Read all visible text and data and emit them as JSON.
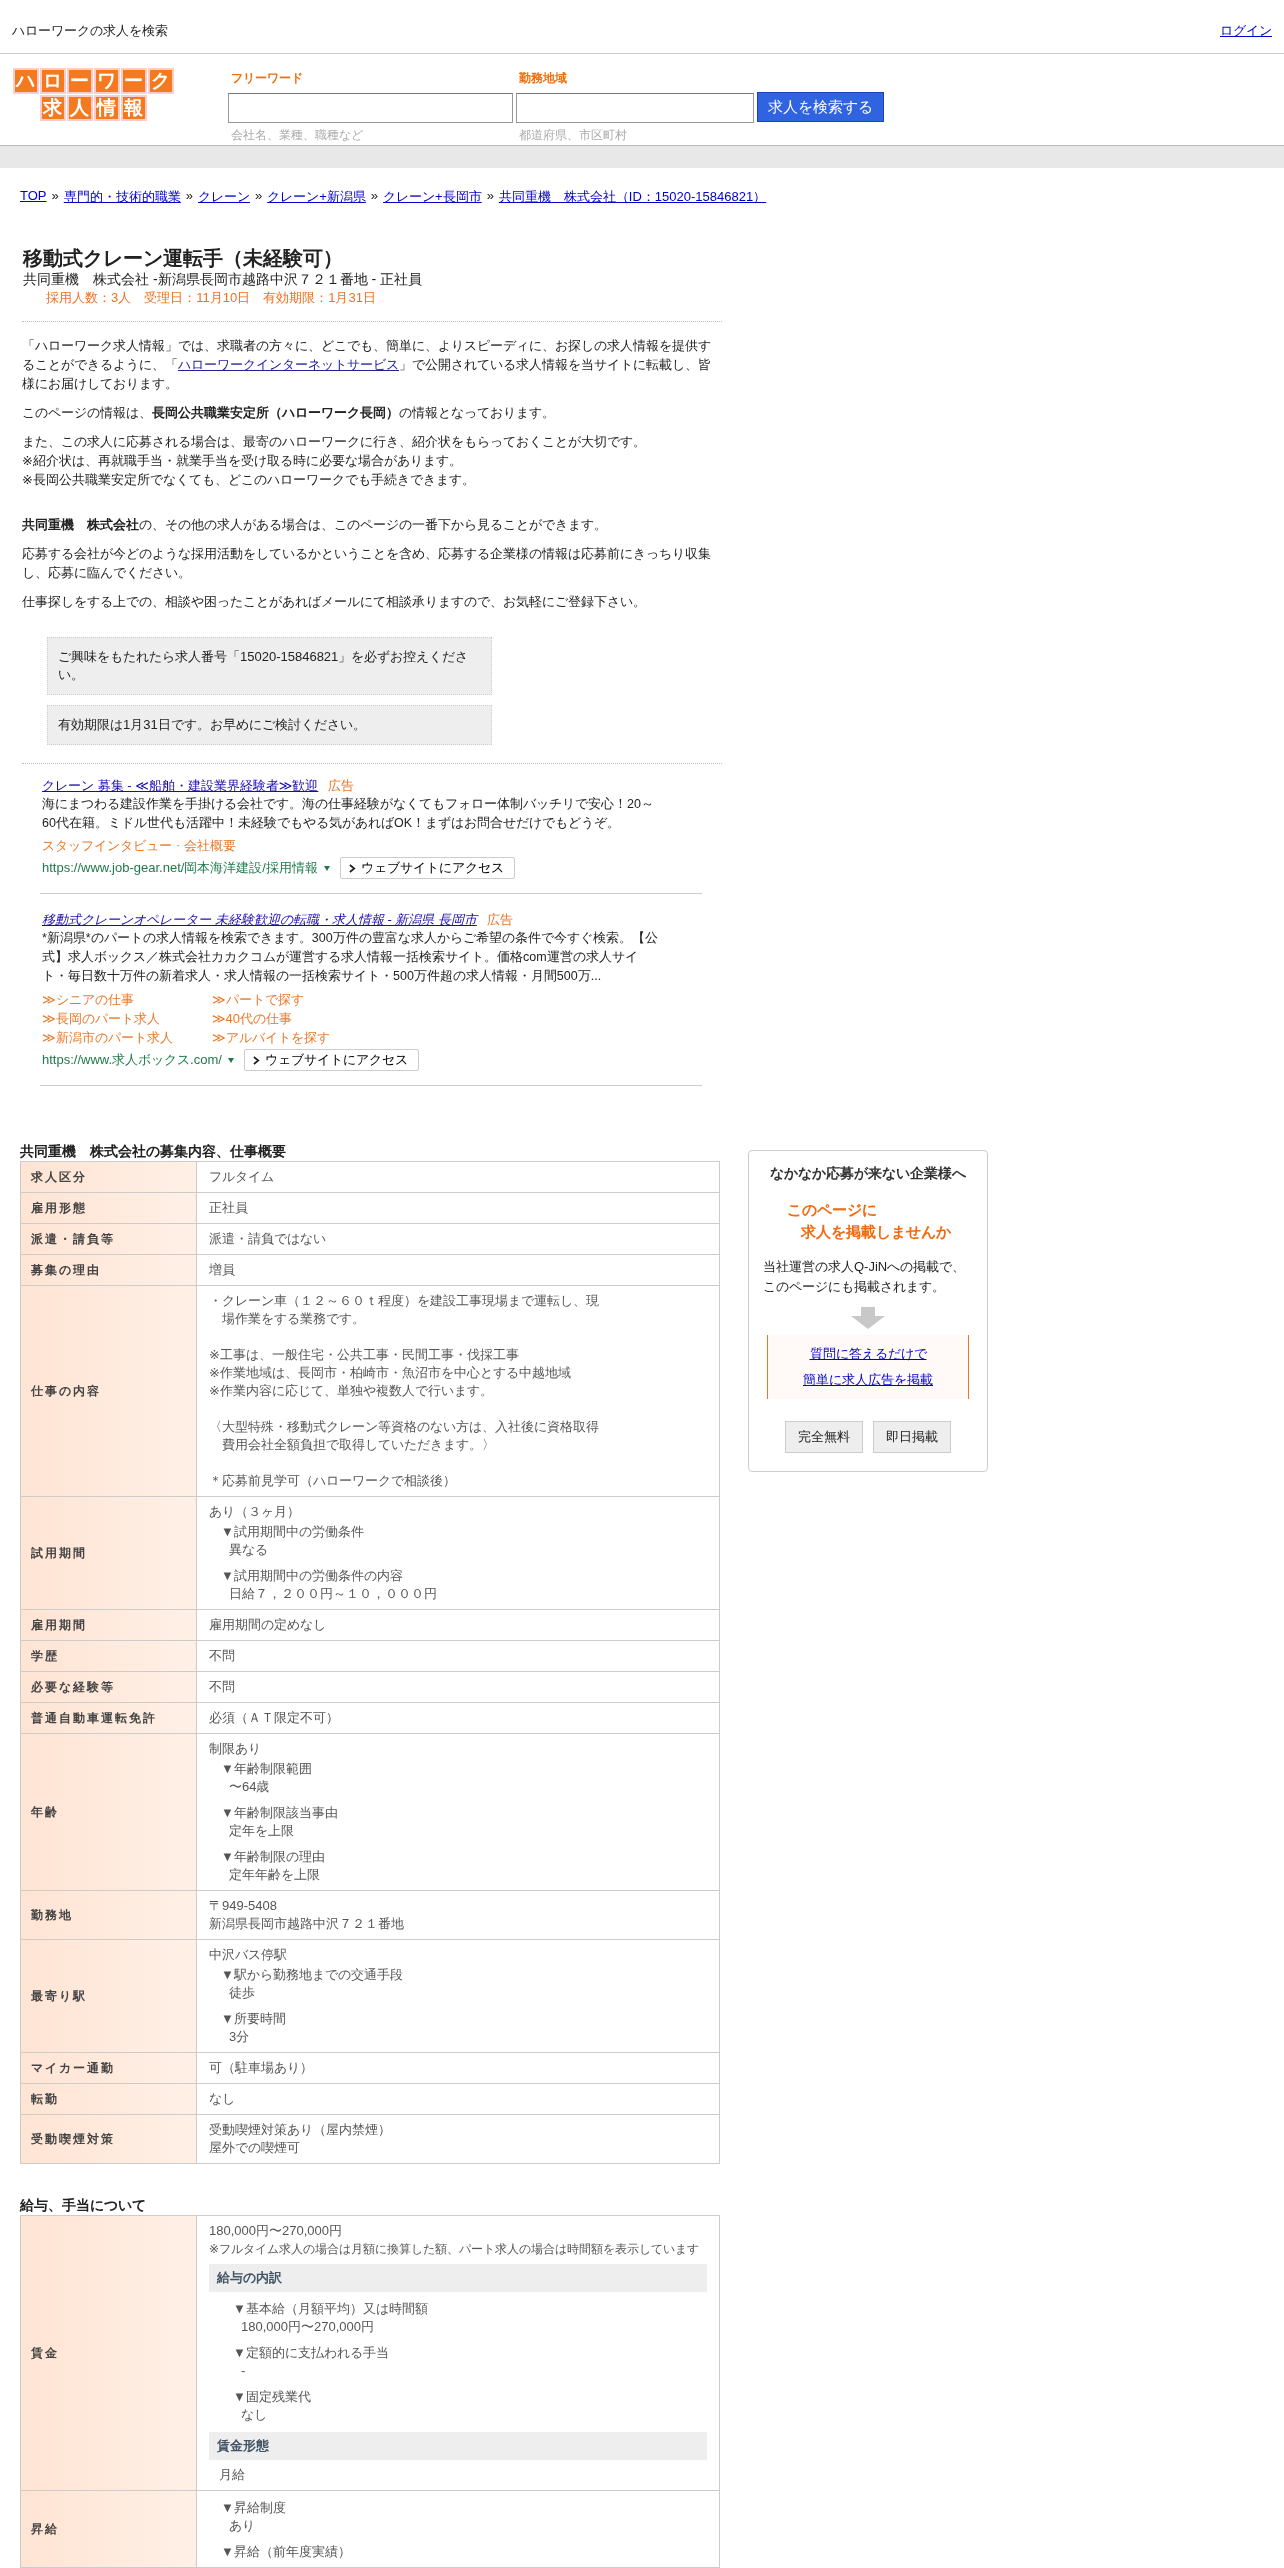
{
  "header": {
    "tagline": "ハローワークの求人を検索",
    "login": "ログイン"
  },
  "logo": {
    "top": [
      "ハ",
      "ロ",
      "ー",
      "ワ",
      "ー",
      "ク"
    ],
    "bottom": [
      "求",
      "人",
      "情",
      "報"
    ]
  },
  "search": {
    "fields": [
      {
        "label": "フリーワード",
        "placeholder": "会社名、業種、職種など",
        "kind": "wide"
      },
      {
        "label": "勤務地域",
        "placeholder": "都道府県、市区町村",
        "kind": "narrow"
      }
    ],
    "button": "求人を検索する"
  },
  "breadcrumb": {
    "separator": "»",
    "items": [
      "TOP",
      "専門的・技術的職業",
      "クレーン",
      "クレーン+新潟県",
      "クレーン+長岡市",
      "共同重機　株式会社（ID：15020-15846821）"
    ]
  },
  "job": {
    "title": "移動式クレーン運転手（未経験可）",
    "subtitle": "共同重機　株式会社 -新潟県長岡市越路中沢７２１番地 - 正社員",
    "meta": "採用人数：3人　受理日：11月10日　有効期限：1月31日"
  },
  "intro": [
    {
      "kind": "linked",
      "before": "「ハローワーク求人情報」では、求職者の方々に、どこでも、簡単に、よりスピーディに、お探しの求人情報を提供することができるように、「",
      "link": "ハローワークインターネットサービス",
      "after": "」で公開されている求人情報を当サイトに転載し、皆様にお届けしております。"
    },
    {
      "kind": "text",
      "lines": [
        "このページの情報は、**長岡公共職業安定所（ハローワーク長岡）**の情報となっております。"
      ]
    },
    {
      "kind": "text",
      "lines": [
        "また、この求人に応募される場合は、最寄のハローワークに行き、紹介状をもらっておくことが大切です。",
        "※紹介状は、再就職手当・就業手当を受け取る時に必要な場合があります。",
        "※長岡公共職業安定所でなくても、どこのハローワークでも手続きできます。"
      ]
    },
    {
      "kind": "spaced",
      "lines": [
        "**共同重機　株式会社**の、その他の求人がある場合は、このページの一番下から見ることができます。"
      ]
    },
    {
      "kind": "text",
      "lines": [
        "応募する会社が今どのような採用活動をしているかということを含め、応募する企業様の情報は応募前にきっちり収集し、応募に臨んでください。"
      ]
    },
    {
      "kind": "text",
      "lines": [
        "仕事探しをする上での、相談や困ったことがあればメールにて相談承りますので、お気軽にご登録下さい。"
      ]
    }
  ],
  "notices": [
    "ご興味をもたれたら求人番号「15020-15846821」を必ずお控えください。",
    "有効期限は1月31日です。お早めにご検討ください。"
  ],
  "ads": [
    {
      "title": "クレーン 募集 - ≪船舶・建設業界経験者≫歓迎",
      "italic": false,
      "badge": "広告",
      "description": "海にまつわる建設作業を手掛ける会社です。海の仕事経験がなくてもフォロー体制バッチリで安心！20～60代在籍。ミドル世代も活躍中！未経験でもやる気があればOK！まずはお問合せだけでもどうぞ。",
      "sitelink_separator": "·",
      "sitelinks": [
        "スタッフインタビュー",
        "会社概要"
      ],
      "url": "https://www.job-gear.net/岡本海洋建設/採用情報",
      "button": "ウェブサイトにアクセス"
    },
    {
      "title": "移動式クレーンオペレーター 未経験歓迎の転職・求人情報 - 新潟県 長岡市",
      "italic": true,
      "badge": "広告",
      "description": "*新潟県*のパートの求人情報を検索できます。300万件の豊富な求人からご希望の条件で今すぐ検索。【公式】求人ボックス／株式会社カカクコムが運営する求人情報一括検索サイト。価格com運営の求人サイト・毎日数十万件の新着求人・求人情報の一括検索サイト・500万件超の求人情報・月間500万...",
      "sitelinks": [
        "≫シニアの仕事",
        "≫パートで探す",
        "≫長岡のパート求人",
        "≫40代の仕事",
        "≫新潟市のパート求人",
        "≫アルバイトを探す"
      ],
      "url": "https://www.求人ボックス.com/",
      "button": "ウェブサイトにアクセス"
    }
  ],
  "overview": {
    "heading": "共同重機　株式会社の募集内容、仕事概要",
    "rows": [
      {
        "label": "求人区分",
        "blocks": [
          {
            "kind": "text",
            "lines": [
              "フルタイム"
            ]
          }
        ]
      },
      {
        "label": "雇用形態",
        "blocks": [
          {
            "kind": "text",
            "lines": [
              "正社員"
            ]
          }
        ]
      },
      {
        "label": "派遣・請負等",
        "blocks": [
          {
            "kind": "text",
            "lines": [
              "派遣・請負ではない"
            ]
          }
        ]
      },
      {
        "label": "募集の理由",
        "blocks": [
          {
            "kind": "text",
            "lines": [
              "増員"
            ]
          }
        ]
      },
      {
        "label": "仕事の内容",
        "blocks": [
          {
            "kind": "hanging",
            "lines": [
              "・クレーン車（１２～６０ｔ程度）を建設工事現場まで運転し、現",
              "場作業をする業務です。"
            ]
          },
          {
            "kind": "text",
            "lines": [
              "※工事は、一般住宅・公共工事・民間工事・伐採工事",
              "※作業地域は、長岡市・柏崎市・魚沼市を中心とする中越地域",
              "※作業内容に応じて、単独や複数人で行います。"
            ]
          },
          {
            "kind": "hanging",
            "lines": [
              "〈大型特殊・移動式クレーン等資格のない方は、入社後に資格取得",
              "費用会社全額負担で取得していただきます。〉"
            ]
          },
          {
            "kind": "text",
            "lines": [
              "＊応募前見学可（ハローワークで相談後）"
            ]
          }
        ]
      },
      {
        "label": "試用期間",
        "blocks": [
          {
            "kind": "text",
            "lines": [
              "あり（３ヶ月）"
            ]
          },
          {
            "kind": "item",
            "head": "▼試用期間中の労働条件",
            "text": "異なる"
          },
          {
            "kind": "item",
            "head": "▼試用期間中の労働条件の内容",
            "text": "日給７，２００円～１０，０００円"
          }
        ]
      },
      {
        "label": "雇用期間",
        "blocks": [
          {
            "kind": "text",
            "lines": [
              "雇用期間の定めなし"
            ]
          }
        ]
      },
      {
        "label": "学歴",
        "blocks": [
          {
            "kind": "text",
            "lines": [
              "不問"
            ]
          }
        ]
      },
      {
        "label": "必要な経験等",
        "blocks": [
          {
            "kind": "text",
            "lines": [
              "不問"
            ]
          }
        ]
      },
      {
        "label": "普通自動車運転免許",
        "blocks": [
          {
            "kind": "text",
            "lines": [
              "必須（ＡＴ限定不可）"
            ]
          }
        ]
      },
      {
        "label": "年齢",
        "blocks": [
          {
            "kind": "text",
            "lines": [
              "制限あり"
            ]
          },
          {
            "kind": "item",
            "head": "▼年齢制限範囲",
            "text": "〜64歳"
          },
          {
            "kind": "item",
            "head": "▼年齢制限該当事由",
            "text": "定年を上限"
          },
          {
            "kind": "item",
            "head": "▼年齢制限の理由",
            "text": "定年年齢を上限"
          }
        ]
      },
      {
        "label": "勤務地",
        "blocks": [
          {
            "kind": "text",
            "lines": [
              "〒949-5408",
              "新潟県長岡市越路中沢７２１番地"
            ]
          }
        ]
      },
      {
        "label": "最寄り駅",
        "blocks": [
          {
            "kind": "text",
            "lines": [
              "中沢バス停駅"
            ]
          },
          {
            "kind": "item",
            "head": "▼駅から勤務地までの交通手段",
            "text": "徒歩"
          },
          {
            "kind": "item",
            "head": "▼所要時間",
            "text": "3分"
          }
        ]
      },
      {
        "label": "マイカー通勤",
        "blocks": [
          {
            "kind": "text",
            "lines": [
              "可（駐車場あり）"
            ]
          }
        ]
      },
      {
        "label": "転勤",
        "blocks": [
          {
            "kind": "text",
            "lines": [
              "なし"
            ]
          }
        ]
      },
      {
        "label": "受動喫煙対策",
        "blocks": [
          {
            "kind": "text",
            "lines": [
              "受動喫煙対策あり（屋内禁煙）",
              "屋外での喫煙可"
            ]
          }
        ]
      }
    ]
  },
  "sidebar": {
    "title": "なかなか応募が来ない企業様へ",
    "highlight": [
      "このページに",
      "求人を掲載しませんか"
    ],
    "description": "当社運営の求人Q-JiNへの掲載で、このページにも掲載されます。",
    "links": [
      "質問に答えるだけで",
      "簡単に求人広告を掲載"
    ],
    "tags": [
      "完全無料",
      "即日掲載"
    ]
  },
  "salary": {
    "heading": "給与、手当について",
    "rows": [
      {
        "label": "賃金",
        "blocks": [
          {
            "kind": "text",
            "lines": [
              "180,000円〜270,000円"
            ]
          },
          {
            "kind": "note",
            "text": "※フルタイム求人の場合は月額に換算した額、パート求人の場合は時間額を表示しています"
          },
          {
            "kind": "subhead",
            "text": "給与の内訳"
          },
          {
            "kind": "deepitem",
            "head": "▼基本給（月額平均）又は時間額",
            "text": "180,000円〜270,000円"
          },
          {
            "kind": "deepitem",
            "head": "▼定額的に支払われる手当",
            "text": "-"
          },
          {
            "kind": "deepitem",
            "head": "▼固定残業代",
            "text": "なし"
          },
          {
            "kind": "subhead",
            "text": "賃金形態"
          },
          {
            "kind": "inset",
            "text": "月給"
          }
        ]
      },
      {
        "label": "昇給",
        "blocks": [
          {
            "kind": "item",
            "head": "▼昇給制度",
            "text": "あり"
          },
          {
            "kind": "headonly",
            "head": "▼昇給（前年度実績）"
          }
        ]
      }
    ]
  }
}
